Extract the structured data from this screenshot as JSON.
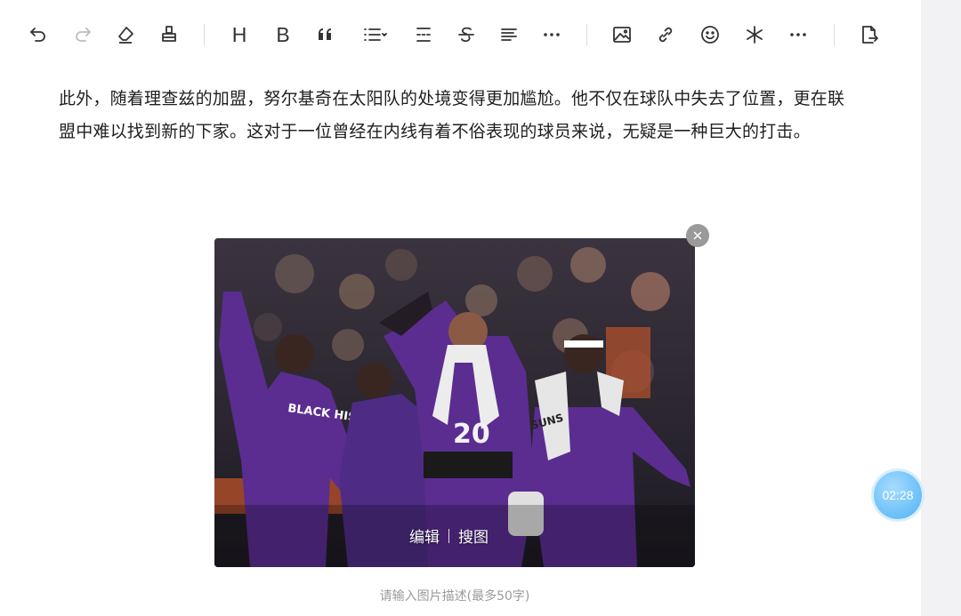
{
  "toolbar": {
    "buttons": [
      {
        "name": "undo-icon"
      },
      {
        "name": "redo-icon"
      },
      {
        "name": "eraser-icon"
      },
      {
        "name": "format-painter-icon"
      },
      {
        "name": "heading-button",
        "label": "H"
      },
      {
        "name": "bold-button",
        "label": "B"
      },
      {
        "name": "quote-icon"
      },
      {
        "name": "list-dropdown-icon"
      },
      {
        "name": "divider-icon"
      },
      {
        "name": "strikethrough-icon"
      },
      {
        "name": "align-icon"
      },
      {
        "name": "more-format-icon"
      },
      {
        "name": "image-icon"
      },
      {
        "name": "link-icon"
      },
      {
        "name": "emoji-icon"
      },
      {
        "name": "sparkle-icon"
      },
      {
        "name": "more-insert-icon"
      },
      {
        "name": "export-document-icon"
      }
    ]
  },
  "content": {
    "paragraph": "此外，随着理查兹的加盟，努尔基奇在太阳队的处境变得更加尴尬。他不仅在球队中失去了位置，更在联盟中难以找到新的下家。这对于一位曾经在内线有着不俗表现的球员来说，无疑是一种巨大的打击。"
  },
  "image": {
    "edit_label": "编辑",
    "search_label": "搜图",
    "caption_placeholder": "请输入图片描述(最多50字)",
    "jersey_text": "BLACK HISTORY BLACK VOICES",
    "jersey_number": "20",
    "team_text": "SUNS"
  },
  "timer": {
    "value": "02:28"
  },
  "colors": {
    "accent": "#4fb2f4",
    "suns_purple": "#5b2d90"
  }
}
